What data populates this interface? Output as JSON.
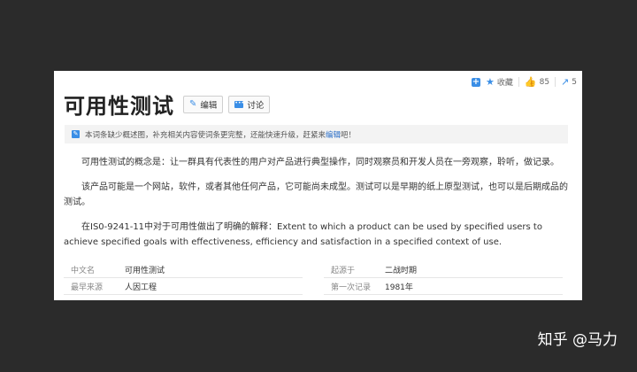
{
  "toolbar": {
    "favorite_label": "收藏",
    "like_count": "85",
    "share_count": "5"
  },
  "page": {
    "title": "可用性测试",
    "edit_label": "编辑",
    "discuss_label": "讨论"
  },
  "notice": {
    "text_before": "本词条缺少概述图，补充相关内容使词条更完整，还能快速升级，赶紧来",
    "link_text": "编辑",
    "text_after": "吧！"
  },
  "paragraphs": [
    "可用性测试的概念是：让一群具有代表性的用户对产品进行典型操作，同时观察员和开发人员在一旁观察，聆听，做记录。",
    "该产品可能是一个网站，软件，或者其他任何产品，它可能尚未成型。测试可以是早期的纸上原型测试，也可以是后期成品的测试。",
    "在IS0-9241-11中对于可用性做出了明确的解释：Extent to which a product can be used by specified users to achieve specified goals with effectiveness, efficiency and satisfaction in a specified context of use."
  ],
  "info": [
    {
      "k1": "中文名",
      "v1": "可用性测试",
      "k2": "起源于",
      "v2": "二战时期"
    },
    {
      "k1": "最早来源",
      "v1": "人因工程",
      "k2": "第一次记录",
      "v2": "1981年"
    }
  ],
  "watermark": "知乎 @马力",
  "colors": {
    "accent": "#3a8ee6",
    "background": "#2b2b2b"
  }
}
